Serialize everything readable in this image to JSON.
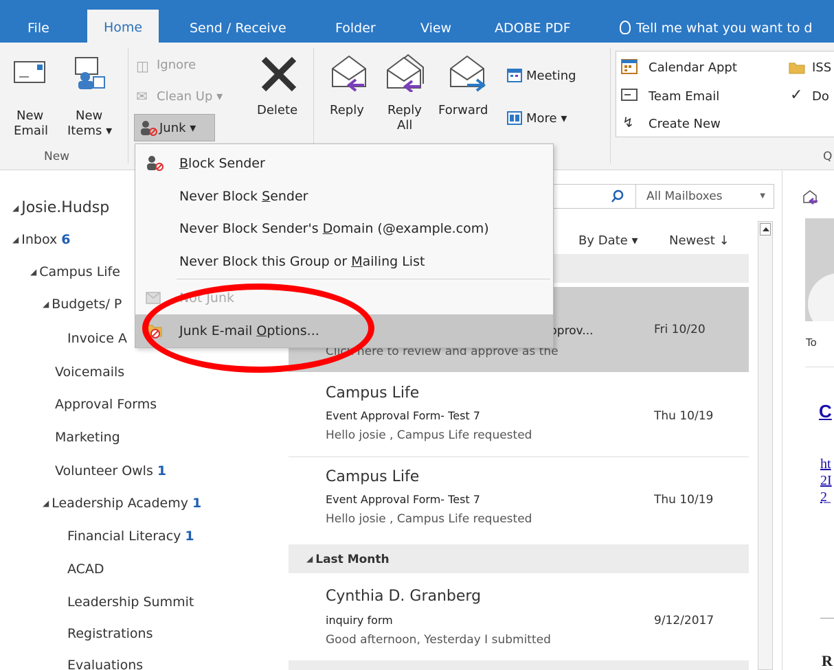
{
  "ribbon_tabs": [
    "File",
    "Home",
    "Send / Receive",
    "Folder",
    "View",
    "ADOBE PDF"
  ],
  "tell_me": "Tell me what you want to d",
  "ribbon": {
    "new_email": [
      "New",
      "Email"
    ],
    "new_items": [
      "New",
      "Items ▾"
    ],
    "ignore": "Ignore",
    "clean_up": "Clean Up ▾",
    "junk": "Junk ▾",
    "delete": "Delete",
    "reply": "Reply",
    "reply_all": [
      "Reply",
      "All"
    ],
    "forward": "Forward",
    "meeting": "Meeting",
    "more": "More ▾",
    "group_new": "New",
    "quick_steps": [
      "Calendar Appt",
      "Team Email",
      "Create New"
    ],
    "quick_steps_right": [
      "ISS",
      "Do"
    ],
    "quick_group_letter": "Q"
  },
  "junk_menu": {
    "items": [
      {
        "pre": "",
        "ul": "B",
        "post": "lock Sender"
      },
      {
        "pre": "Never Block ",
        "ul": "S",
        "post": "ender"
      },
      {
        "pre": "Never Block Sender's ",
        "ul": "D",
        "post": "omain (@example.com)"
      },
      {
        "pre": "Never Block this Group or ",
        "ul": "M",
        "post": "ailing List"
      },
      {
        "pre": "Not Junk",
        "ul": "",
        "post": ""
      },
      {
        "pre": "Junk E-mail ",
        "ul": "O",
        "post": "ptions..."
      }
    ]
  },
  "folders": {
    "account": "Josie.Hudsp",
    "inbox": "Inbox",
    "inbox_count": "6",
    "campus_life": "Campus Life",
    "budgets": "Budgets/ P",
    "invoice": "Invoice A",
    "voicemails": "Voicemails",
    "approval_forms": "Approval Forms",
    "marketing": "Marketing",
    "volunteer_owls": "Volunteer Owls",
    "volunteer_owls_count": "1",
    "leadership_academy": "Leadership Academy",
    "leadership_academy_count": "1",
    "financial_literacy": "Financial Literacy",
    "financial_literacy_count": "1",
    "acad": "ACAD",
    "leadership_summit": "Leadership Summit",
    "registrations": "Registrations",
    "evaluations": "Evaluations"
  },
  "search": {
    "scope": "All Mailboxes"
  },
  "sort": {
    "by": "By Date ▾",
    "order": "Newest ↓"
  },
  "messages": [
    {
      "subject_tail": "pprov...",
      "preview": "Click here to review and approve as the",
      "date": "Fri 10/20"
    },
    {
      "from": "Campus Life",
      "subject": "Event Approval Form- Test 7",
      "preview": "Hello josie ,  Campus Life requested",
      "date": "Thu 10/19"
    },
    {
      "from": "Campus Life",
      "subject": "Event Approval Form- Test 7",
      "preview": "Hello josie ,  Campus Life requested",
      "date": "Thu 10/19"
    },
    {
      "from": "Cynthia D. Granberg",
      "subject": "inquiry form",
      "preview": "Good afternoon,  Yesterday I submitted",
      "date": "9/12/2017"
    }
  ],
  "group_headers": {
    "last_month": "Last Month"
  },
  "reading": {
    "to": "To",
    "link_c": "C",
    "link_lines": [
      "ht",
      "2I",
      "2̲"
    ],
    "bottom_letter": "R"
  },
  "colors": {
    "ribbon_blue": "#2b78c5",
    "count_blue": "#1f5fb4",
    "annotation_red": "#ff0000",
    "link_blue": "#1a0dab"
  }
}
